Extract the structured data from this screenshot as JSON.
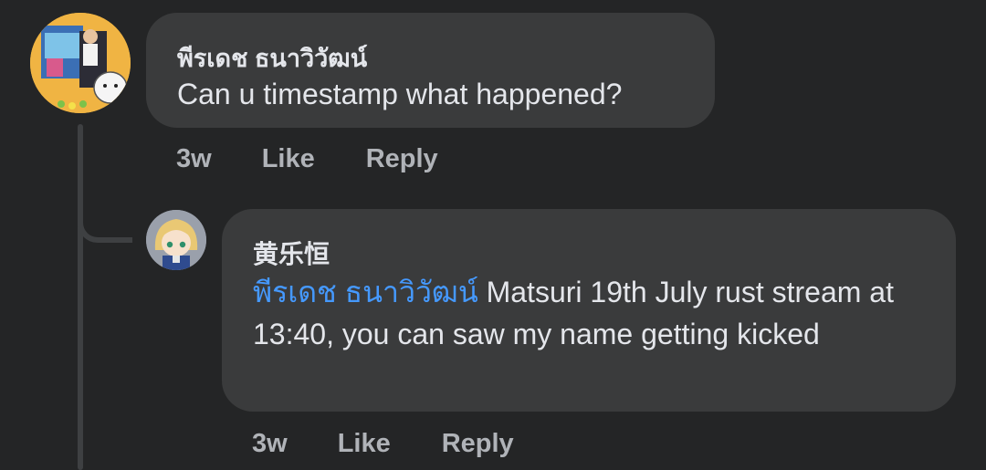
{
  "comments": [
    {
      "author": "พีรเดช ธนาวิวัฒน์",
      "text": "Can u timestamp what happened?",
      "time": "3w",
      "like_label": "Like",
      "reply_label": "Reply"
    },
    {
      "author": "黄乐恒",
      "mention": "พีรเดช ธนาวิวัฒน์",
      "text": " Matsuri 19th July rust stream at 13:40, you can saw my name getting kicked",
      "time": "3w",
      "like_label": "Like",
      "reply_label": "Reply"
    }
  ],
  "colors": {
    "background": "#242526",
    "bubble": "#3a3b3c",
    "mention": "#4599ff",
    "secondary_text": "#b0b3b8"
  },
  "icons": {
    "avatar_1": "user-avatar-photo-collage",
    "avatar_2": "user-avatar-anime-character"
  }
}
